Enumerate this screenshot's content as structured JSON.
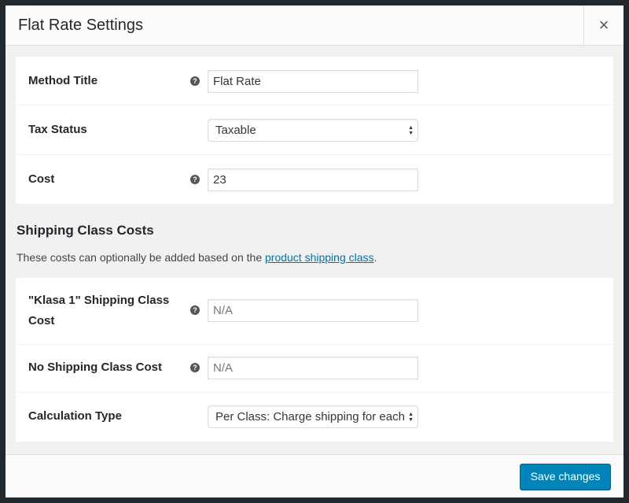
{
  "modal": {
    "title": "Flat Rate Settings",
    "close_label": "×"
  },
  "settings": [
    {
      "label": "Method Title",
      "help": true,
      "type": "text",
      "value": "Flat Rate"
    },
    {
      "label": "Tax Status",
      "help": false,
      "type": "select",
      "value": "Taxable"
    },
    {
      "label": "Cost",
      "help": true,
      "type": "text",
      "value": "23"
    }
  ],
  "shipping_class_costs": {
    "heading": "Shipping Class Costs",
    "description_prefix": "These costs can optionally be added based on the ",
    "description_link": "product shipping class",
    "description_suffix": ".",
    "rows": [
      {
        "label": "\"Klasa 1\" Shipping Class Cost",
        "help": true,
        "type": "text",
        "value": "",
        "placeholder": "N/A"
      },
      {
        "label": "No Shipping Class Cost",
        "help": true,
        "type": "text",
        "value": "",
        "placeholder": "N/A"
      },
      {
        "label": "Calculation Type",
        "help": false,
        "type": "select",
        "value": "Per Class: Charge shipping for each"
      }
    ]
  },
  "help_icon_glyph": "?",
  "footer": {
    "save_label": "Save changes"
  },
  "colors": {
    "primary_button": "#0085ba",
    "link": "#0073aa"
  }
}
